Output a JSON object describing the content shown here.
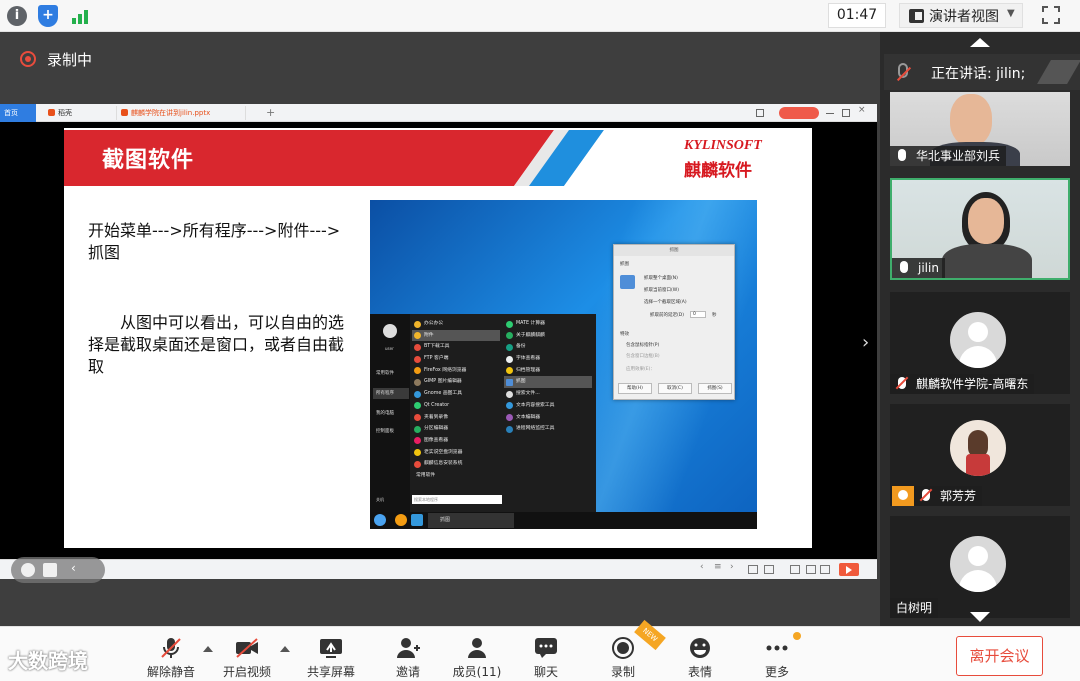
{
  "topbar": {
    "timer": "01:47",
    "view_mode": "演讲者视图",
    "icons": [
      "info-icon",
      "shield-icon",
      "signal-icon",
      "fullscreen-icon"
    ]
  },
  "recording": {
    "label": "录制中",
    "color": "#e84c3d"
  },
  "browser": {
    "tabs": [
      "首页",
      "稻壳",
      "麒麟学院在讲到jilin.pptx"
    ],
    "plus": "+"
  },
  "slide": {
    "title": "截图软件",
    "logo_en": "KYLINSOFT",
    "logo_cn": "麒麟软件",
    "text1": "开始菜单--->所有程序--->附件--->抓图",
    "text2": "从图中可以看出，可以自由的选择是截取桌面还是窗口，或者自由截取"
  },
  "screenshot": {
    "user": "user",
    "left_nav": [
      "常用软件",
      "所有程序",
      "我的电脑",
      "控制面板"
    ],
    "col1": [
      "办公办公",
      "附件",
      "BT下载工具",
      "FTP 客户端",
      "FireFox 网络浏览器",
      "GIMP 图片编辑器",
      "Gnome 画图工具",
      "Qt Creator",
      "夹着到录像",
      "分区编辑器",
      "图像查看器",
      "老实说空盘浏览器",
      "麒麟信息安装系统"
    ],
    "col1_footer": "常用软件",
    "col2": [
      "MATE 计算器",
      "关于麒麟麒麟",
      "备份",
      "字体查看器",
      "归档管理器",
      "抓图",
      "搜索文件...",
      "文本内容搜索工具",
      "文本编辑器",
      "进程网络监控工具"
    ],
    "search_placeholder": "搜索本地程序",
    "shutdown": "关机",
    "task_label": "抓图",
    "dialog": {
      "title": "抓图",
      "section1": "抓图",
      "opt1": "抓取整个桌面(N)",
      "opt2": "抓取当前窗口(W)",
      "opt3": "选择一个截取区域(A)",
      "delay_label": "抓取前的延迟(D)",
      "delay_value": "0",
      "delay_unit": "秒",
      "section2": "特效",
      "eff1": "包含鼠标指针(P)",
      "eff2": "包含窗口边框(B)",
      "eff3": "应用效果(E)：",
      "btn_help": "帮助(H)",
      "btn_cancel": "取消(C)",
      "btn_ok": "抓图(S)"
    }
  },
  "side": {
    "speaking_label": "正在讲话: jilin;",
    "participants": [
      {
        "name": "华北事业部刘兵",
        "muted": false
      },
      {
        "name": "jilin",
        "muted": false
      },
      {
        "name": "麒麟软件学院-高曙东",
        "muted": true
      },
      {
        "name": "郭芳芳",
        "muted": true
      },
      {
        "name": "白树明",
        "muted": null
      }
    ]
  },
  "toolbar": {
    "watermark": "大数跨境",
    "items": [
      "解除静音",
      "开启视频",
      "共享屏幕",
      "邀请",
      "成员(11)",
      "聊天",
      "录制",
      "表情",
      "更多"
    ],
    "new_badge": "NEW",
    "leave": "离开会议"
  },
  "colors": {
    "accent": "#2f7de1",
    "danger": "#e74c3c",
    "slide_red": "#d71920"
  }
}
